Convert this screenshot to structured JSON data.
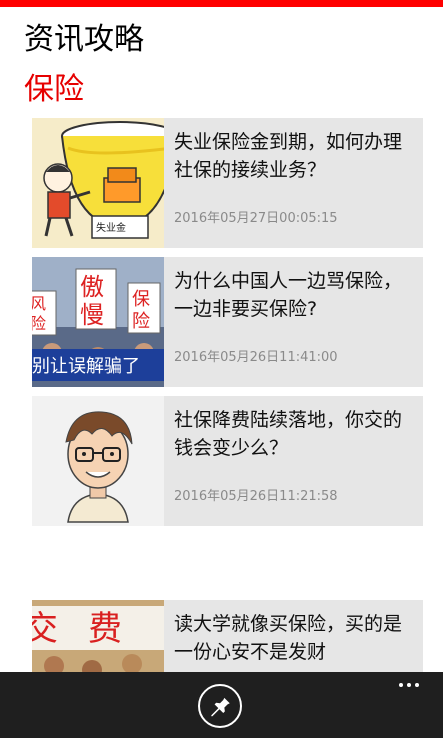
{
  "header": {
    "app_title": "资讯攻略",
    "section_title": "保险"
  },
  "articles": [
    {
      "title": "失业保险金到期，如何办理社保的接续业务？",
      "date": "2016年05月27日00:05:15",
      "thumb_icon": "unemployment-insurance-bowl-illustration",
      "thumb_caption": "失业金"
    },
    {
      "title": "为什么中国人一边骂保险，一边非要买保险?",
      "date": "2016年05月26日11:41:00",
      "thumb_icon": "protest-signs-photo",
      "thumb_signs": [
        "傲",
        "慢",
        "保",
        "险",
        "风",
        "险",
        "别让误解骗了"
      ]
    },
    {
      "title": "社保降费陆续落地，你交的钱会变少么？",
      "date": "2016年05月26日11:21:58",
      "thumb_icon": "cartoon-man-glasses-illustration"
    },
    {
      "title": "读大学就像买保险，买的是一份心安不是发财",
      "date": "",
      "thumb_icon": "tuition-fee-sign-photo",
      "thumb_signs": [
        "交",
        "费"
      ]
    }
  ],
  "app_bar": {
    "pin_icon": "pin-icon",
    "more_icon": "more-ellipsis-icon"
  },
  "colors": {
    "accent": "#ff0000",
    "section_title": "#e60000",
    "card_bg": "#e6e6e6",
    "app_bar_bg": "#1f1f1f",
    "date_text": "#8a8a8a"
  }
}
